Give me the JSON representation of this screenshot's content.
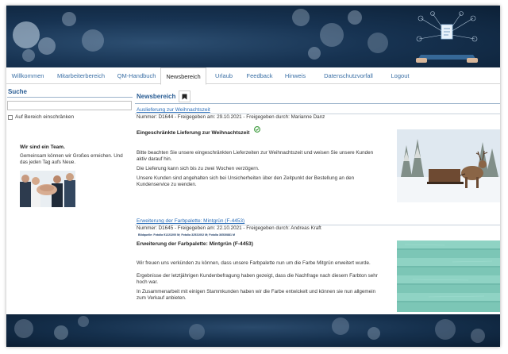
{
  "nav": {
    "tabs": [
      {
        "label": "Willkommen"
      },
      {
        "label": "Mitarbeiterbereich"
      },
      {
        "label": "QM-Handbuch"
      },
      {
        "label": "Newsbereich",
        "active": true
      },
      {
        "label": "Urlaub"
      },
      {
        "label": "Feedback"
      },
      {
        "label": "Hinweis"
      },
      {
        "label": "Datenschutzvorfall"
      },
      {
        "label": "Logout"
      }
    ]
  },
  "sidebar": {
    "search_title": "Suche",
    "search_value": "",
    "checkbox_label": "Auf Bereich einschränken",
    "checkbox_checked": false,
    "team_title": "Wir sind ein Team.",
    "team_text": "Gemeinsam können wir Großes erreichen. Und das jeden Tag aufs Neue."
  },
  "main": {
    "header_title": "Newsbereich",
    "articles": [
      {
        "title": "Auslieferung zur Weihnachtszeit",
        "meta": "Nummer: D1644 - Freigegeben am: 29.10.2021 - Freigegeben durch: Marianne Danz",
        "heading": "Eingeschränkte Lieferung zur Weihnachtszeit",
        "paragraphs": [
          "Bitte beachten Sie unsere eingeschränkten Lieferzeiten zur Weihnachtszeit und weisen Sie unsere Kunden aktiv darauf hin.",
          "Die Lieferung kann sich bis zu zwei Wochen verzögern.",
          "Unsere Kunden sind angehalten sich bei Unsicherheiten über den Zeitpunkt der Bestellung an den Kundenservice zu wenden."
        ]
      },
      {
        "title": "Erweiterung der Farbpalette: Mintgrün (F-4453)",
        "meta": "Nummer: D1645 - Freigegeben am: 22.10.2021 - Freigegeben durch: Andreas Kraft",
        "heading": "Erweiterung der Farbpalette: Mintgrün (F-4453)",
        "paragraphs": [
          "Wir freuen uns verkünden zu können, dass unsere Farbpalette nun um die Farbe Mitgrün erweitert wurde.",
          "Ergebnisse der letztjährigen Kundenbefragung haben gezeigt, dass die Nachfrage nach diesem Farbton sehr hoch war.",
          "In Zusammenarbeit mit einigen Stammkunden haben wir die Farbe entwickelt und können sie nun allgemein zum Verkauf anbieten."
        ]
      }
    ],
    "credits": "Bildquelle: Fotolia 91223200 M; Fotolia 32531002 M; Fotolia 36530881 M"
  },
  "colors": {
    "link": "#2a6db8",
    "heading_blue": "#2a5d94",
    "banner_dark": "#0c2036",
    "mint": "#7cc6b6"
  },
  "icons": [
    "bookmark-icon",
    "refresh-icon",
    "document-icon"
  ]
}
